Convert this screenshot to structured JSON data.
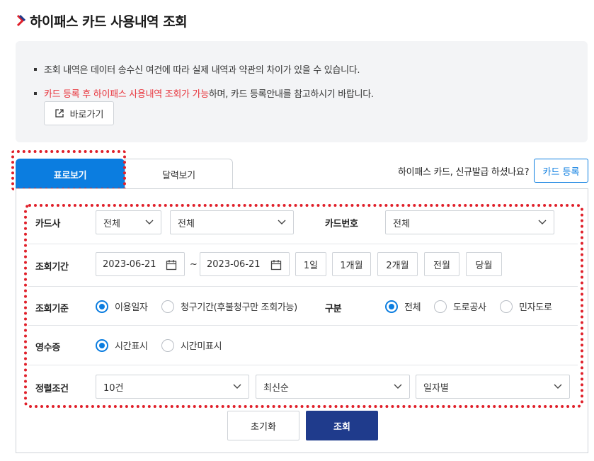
{
  "page": {
    "title": "하이패스 카드 사용내역 조회"
  },
  "notice": {
    "line1": "조회 내역은 데이터 송수신 여건에 따라 실제 내역과 약관의 차이가 있을 수 있습니다.",
    "line2_red": "카드 등록 후 하이패스 사용내역 조회가 가능",
    "line2_rest": "하며, 카드 등록안내를 참고하시기 바랍니다.",
    "goto_button": "바로가기"
  },
  "tabs": [
    {
      "label": "표로보기",
      "active": true
    },
    {
      "label": "달력보기",
      "active": false
    }
  ],
  "register": {
    "question": "하이패스 카드, 신규발급 하셨나요?",
    "button": "카드 등록"
  },
  "form": {
    "card_company": {
      "label": "카드사",
      "select1": "전체",
      "select2": "전체"
    },
    "card_number": {
      "label": "카드번호",
      "select": "전체"
    },
    "period": {
      "label": "조회기간",
      "start": "2023-06-21",
      "separator": "~",
      "end": "2023-06-21",
      "buttons": [
        "1일",
        "1개월",
        "2개월",
        "전월",
        "당월"
      ]
    },
    "basis": {
      "label": "조회기준",
      "options": [
        {
          "label": "이용일자",
          "checked": true
        },
        {
          "label": "청구기간(후불청구만 조회가능)",
          "checked": false
        }
      ]
    },
    "category": {
      "label": "구분",
      "options": [
        {
          "label": "전체",
          "checked": true
        },
        {
          "label": "도로공사",
          "checked": false
        },
        {
          "label": "민자도로",
          "checked": false
        }
      ]
    },
    "receipt": {
      "label": "영수증",
      "options": [
        {
          "label": "시간표시",
          "checked": true
        },
        {
          "label": "시간미표시",
          "checked": false
        }
      ]
    },
    "sort": {
      "label": "정렬조건",
      "count": "10건",
      "order": "최신순",
      "group": "일자별"
    }
  },
  "actions": {
    "reset": "초기화",
    "search": "조회"
  },
  "colors": {
    "accent": "#0b7de0",
    "navy": "#1f3b8c",
    "highlight_red": "#e8343c",
    "dash_red": "#e0202a"
  }
}
